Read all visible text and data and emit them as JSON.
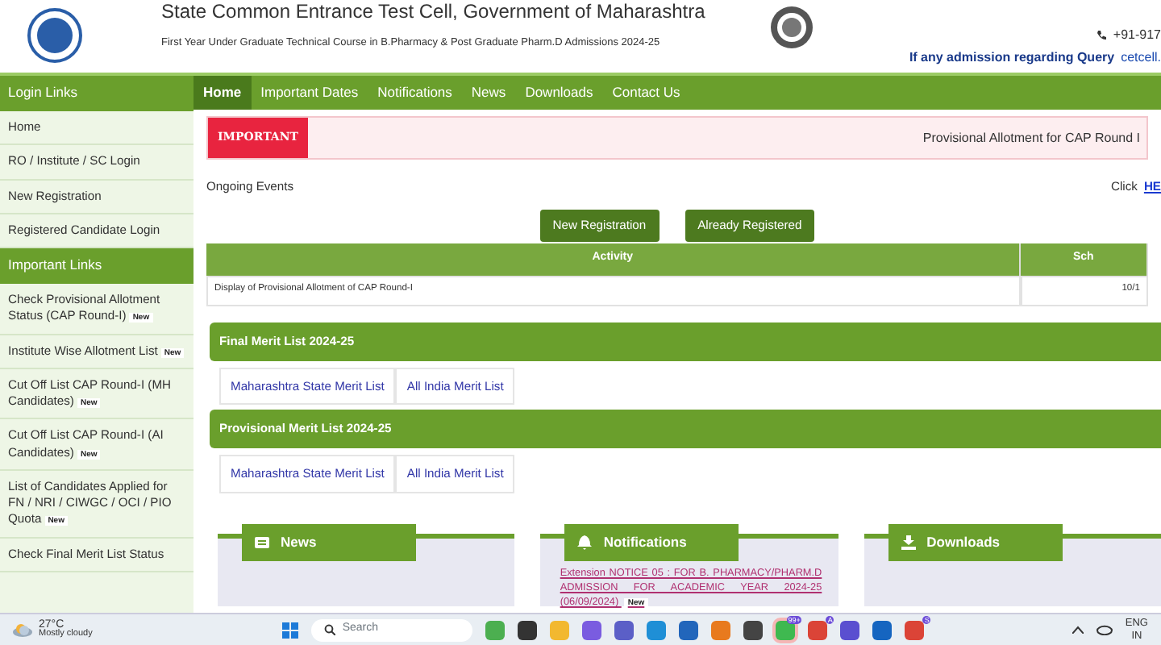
{
  "header": {
    "title": "State Common Entrance Test Cell, Government of Maharashtra",
    "subtitle": "First Year Under Graduate Technical Course in B.Pharmacy & Post Graduate Pharm.D Admissions 2024-25",
    "phone": "+91-917",
    "query_label": "If any admission regarding Query",
    "query_link": "cetcell."
  },
  "sidebar": [
    {
      "kind": "heading",
      "label": "Login Links"
    },
    {
      "kind": "item",
      "label": "Home"
    },
    {
      "kind": "item",
      "label": "RO / Institute / SC Login"
    },
    {
      "kind": "item",
      "label": "New Registration"
    },
    {
      "kind": "item",
      "label": "Registered Candidate Login"
    },
    {
      "kind": "heading",
      "label": "Important Links"
    },
    {
      "kind": "item",
      "label": "Check Provisional Allotment Status (CAP Round-I)",
      "badge": "New"
    },
    {
      "kind": "item",
      "label": "Institute Wise Allotment List",
      "badge": "New"
    },
    {
      "kind": "item",
      "label": "Cut Off List CAP Round-I (MH Candidates)",
      "badge": "New"
    },
    {
      "kind": "item",
      "label": "Cut Off List CAP Round-I (AI Candidates)",
      "badge": "New"
    },
    {
      "kind": "item",
      "label": "List of Candidates Applied for FN / NRI / CIWGC / OCI / PIO Quota",
      "badge": "New"
    },
    {
      "kind": "item",
      "label": "Check Final Merit List Status"
    }
  ],
  "nav": [
    {
      "label": "Home",
      "selected": true
    },
    {
      "label": "Important Dates",
      "selected": false
    },
    {
      "label": "Notifications",
      "selected": false
    },
    {
      "label": "News",
      "selected": false
    },
    {
      "label": "Downloads",
      "selected": false
    },
    {
      "label": "Contact Us",
      "selected": false
    }
  ],
  "important": {
    "label": "IMPORTANT",
    "ticker": "Provisional Allotment for CAP Round I"
  },
  "ongoing": {
    "title": "Ongoing Events",
    "click": "Click",
    "link": "HE"
  },
  "buttons": [
    "New Registration",
    "Already Registered"
  ],
  "table": {
    "columns": [
      "Activity",
      "Sch"
    ],
    "rows": [
      [
        "Display of Provisional Allotment of CAP Round-I",
        "10/1"
      ]
    ]
  },
  "merit_sections": [
    {
      "title": "Final Merit List 2024-25",
      "links": [
        "Maharashtra State Merit List",
        "All India Merit List"
      ]
    },
    {
      "title": "Provisional Merit List 2024-25",
      "links": [
        "Maharashtra State Merit List",
        "All India Merit List"
      ]
    }
  ],
  "panels": [
    {
      "kind": "news",
      "title": "News"
    },
    {
      "kind": "notifications",
      "title": "Notifications",
      "entries": [
        {
          "text": "Extension NOTICE 05 : FOR B. PHARMACY/PHARM.D ADMISSION FOR ACADEMIC YEAR 2024-25 (06/09/2024)",
          "badge": "New"
        }
      ]
    },
    {
      "kind": "downloads",
      "title": "Downloads"
    }
  ],
  "taskbar": {
    "weather_temp": "27°C",
    "weather_text": "Mostly cloudy",
    "search": "Search",
    "apps": [
      {
        "kind": "green"
      },
      {
        "kind": "dark"
      },
      {
        "kind": "folder"
      },
      {
        "kind": "copilot"
      },
      {
        "kind": "teams"
      },
      {
        "kind": "edge"
      },
      {
        "kind": "store"
      },
      {
        "kind": "orange"
      },
      {
        "kind": "sublime"
      },
      {
        "kind": "whatsapp",
        "badge": "99+",
        "selected": true
      },
      {
        "kind": "chrome",
        "badge": "A",
        "selected": false
      },
      {
        "kind": "purple"
      },
      {
        "kind": "outlook"
      },
      {
        "kind": "chrome",
        "badge": "S",
        "selected": false
      }
    ],
    "lang": "ENG",
    "region": "IN"
  }
}
